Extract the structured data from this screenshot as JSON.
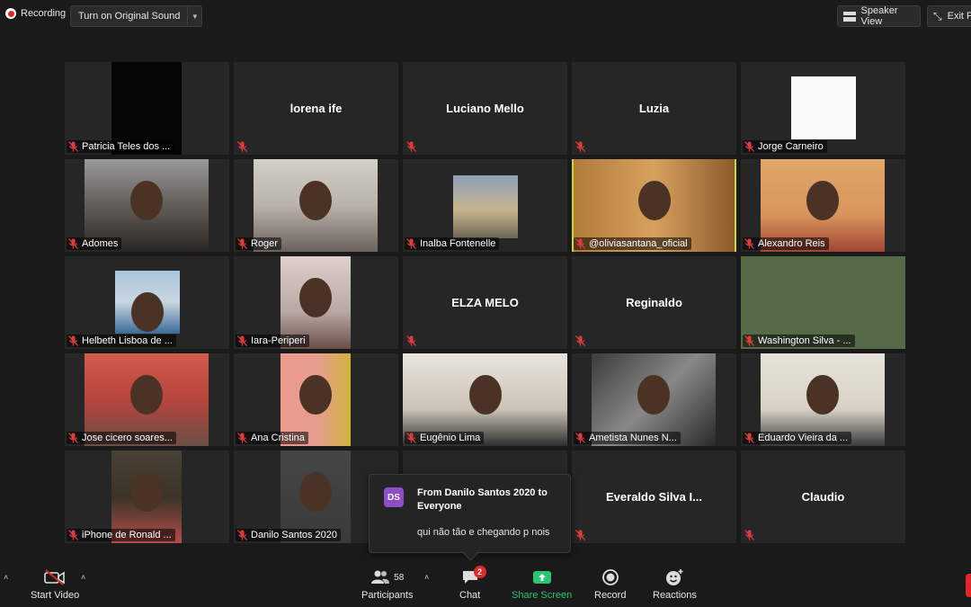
{
  "topbar": {
    "recording_label": "Recording",
    "original_sound_label": "Turn on Original Sound",
    "speaker_view_label": "Speaker View",
    "exit_label": "Exit F"
  },
  "participants": [
    {
      "name": "Patricia Teles dos ...",
      "display": "",
      "video": "black"
    },
    {
      "name": "",
      "display": "lorena ife",
      "video": "none"
    },
    {
      "name": "",
      "display": "Luciano Mello",
      "video": "none"
    },
    {
      "name": "",
      "display": "Luzia",
      "video": "none"
    },
    {
      "name": "Jorge Carneiro",
      "display": "",
      "video": "white"
    },
    {
      "name": "Adomes",
      "display": "",
      "video": "face"
    },
    {
      "name": "Roger",
      "display": "",
      "video": "room"
    },
    {
      "name": "Inalba Fontenelle",
      "display": "",
      "video": "sunset"
    },
    {
      "name": "@oliviasantana_oficial",
      "display": "",
      "video": "wood",
      "active": true
    },
    {
      "name": "Alexandro Reis",
      "display": "",
      "video": "orange"
    },
    {
      "name": "Helbeth Lisboa de ...",
      "display": "",
      "video": "sky"
    },
    {
      "name": "Iara-Periperi",
      "display": "",
      "video": "pink"
    },
    {
      "name": "",
      "display": "ELZA MELO",
      "video": "none"
    },
    {
      "name": "",
      "display": "Reginaldo",
      "video": "none"
    },
    {
      "name": "Washington Silva - ...",
      "display": "",
      "video": "green"
    },
    {
      "name": "Jose cicero soares...",
      "display": "",
      "video": "red"
    },
    {
      "name": "Ana Cristina",
      "display": "",
      "video": "yellow"
    },
    {
      "name": "Eugênio Lima",
      "display": "",
      "video": "wall"
    },
    {
      "name": "Ametista Nunes N...",
      "display": "",
      "video": "gray"
    },
    {
      "name": "Eduardo Vieira da ...",
      "display": "",
      "video": "beige"
    },
    {
      "name": "iPhone de Ronald ...",
      "display": "",
      "video": "night"
    },
    {
      "name": "Danilo Santos 2020",
      "display": "",
      "video": "dark"
    },
    {
      "name": "",
      "display": "",
      "video": "none"
    },
    {
      "name": "",
      "display": "Everaldo  Silva  I...",
      "video": "none"
    },
    {
      "name": "",
      "display": "Claudio",
      "video": "none"
    }
  ],
  "chat_popup": {
    "avatar_initials": "DS",
    "from": "From Danilo Santos 2020 to Everyone",
    "message": "qui não tão e chegando p nois"
  },
  "toolbar": {
    "start_video_label": "Start Video",
    "participants_label": "Participants",
    "participants_count": "58",
    "chat_label": "Chat",
    "chat_badge": "2",
    "share_screen_label": "Share Screen",
    "record_label": "Record",
    "reactions_label": "Reactions"
  },
  "colors": {
    "active_speaker_border": "#c7d93a",
    "share_green": "#28c76f",
    "recording_red": "#e02828",
    "avatar_purple": "#8e4ec6",
    "background": "#1a1a1a"
  },
  "icons": [
    "record-dot-icon",
    "speaker-view-icon",
    "exit-fullscreen-icon",
    "muted-mic-icon",
    "video-off-icon",
    "participants-icon",
    "chat-icon",
    "share-screen-icon",
    "record-icon",
    "reactions-icon",
    "chevron-up-icon",
    "chevron-down-icon"
  ]
}
